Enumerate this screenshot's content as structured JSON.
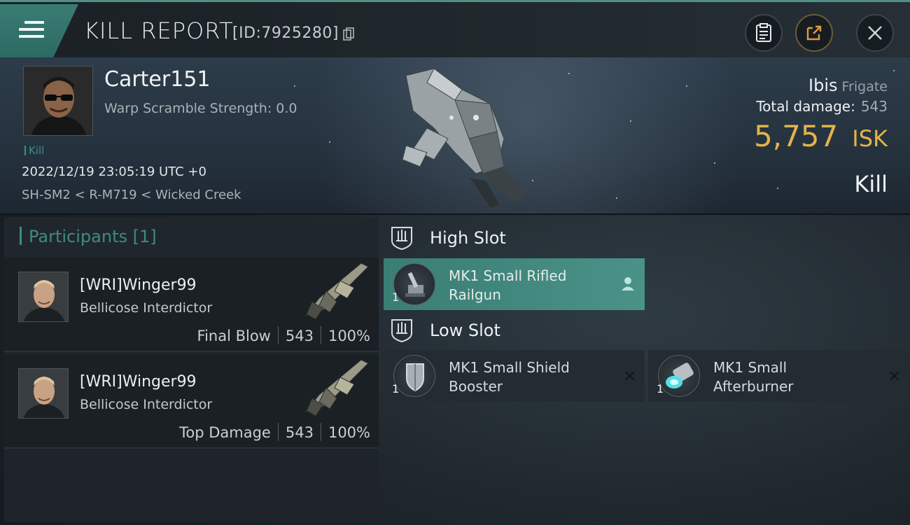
{
  "header": {
    "title": "KILL REPORT",
    "report_id": "[ID:7925280]"
  },
  "victim": {
    "name": "Carter151",
    "warp_scramble": "Warp Scramble Strength: 0.0",
    "kill_count": "Kill",
    "timestamp": "2022/12/19 23:05:19 UTC +0",
    "location": "SH-SM2 < R-M719 < Wicked Creek",
    "ship_name": "Ibis",
    "ship_class": "Frigate",
    "total_damage_label": "Total damage:",
    "total_damage_value": "543",
    "isk_value": "5,757",
    "isk_unit": "ISK",
    "result": "Kill"
  },
  "participants": {
    "header": "Participants [1]",
    "items": [
      {
        "name": "[WRI]Winger99",
        "ship": "Bellicose Interdictor",
        "role": "Final Blow",
        "damage": "543",
        "percent": "100%"
      },
      {
        "name": "[WRI]Winger99",
        "ship": "Bellicose Interdictor",
        "role": "Top Damage",
        "damage": "543",
        "percent": "100%"
      }
    ]
  },
  "slots": {
    "high": {
      "title": "High Slot",
      "modules": [
        {
          "line1": "MK1 Small Rifled",
          "line2": "Railgun",
          "qty": "1"
        }
      ]
    },
    "low": {
      "title": "Low Slot",
      "modules": [
        {
          "line1": "MK1 Small Shield",
          "line2": "Booster",
          "qty": "1"
        },
        {
          "line1": "MK1 Small",
          "line2": "Afterburner",
          "qty": "1"
        }
      ]
    }
  },
  "colors": {
    "accent_teal": "#3f8a82",
    "isk_gold": "#e3b34a",
    "highlight": "#4a9288"
  }
}
